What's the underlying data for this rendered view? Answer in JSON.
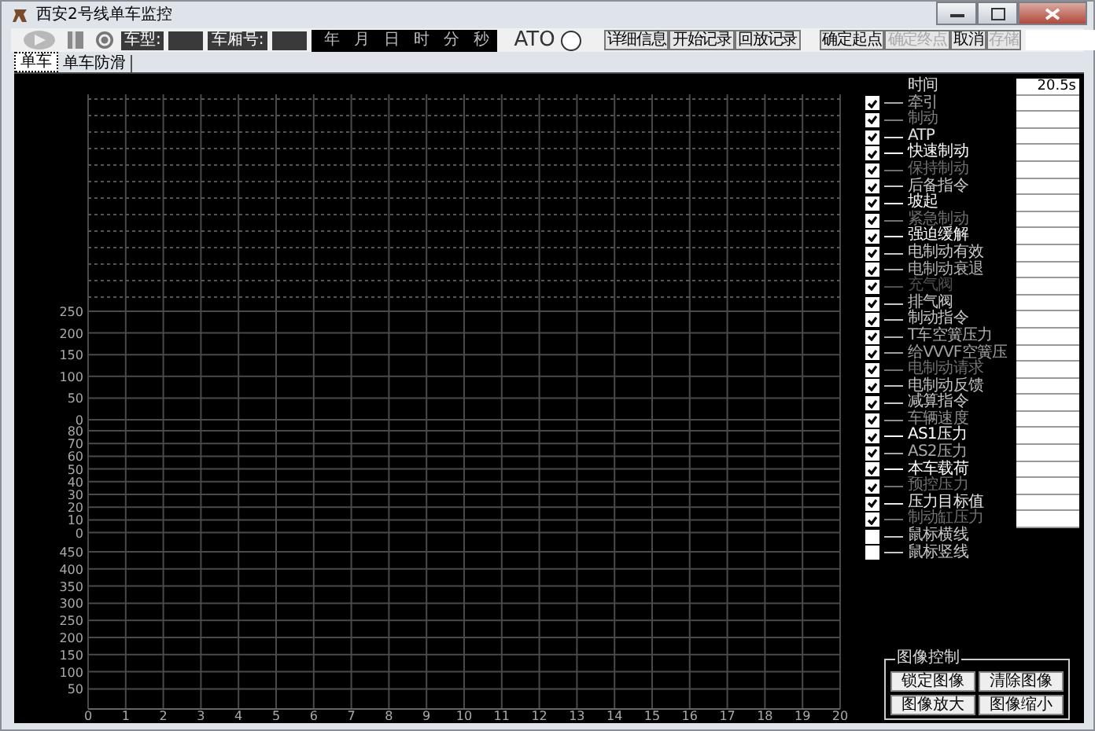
{
  "window": {
    "title": "西安2号线单车监控"
  },
  "toolbar": {
    "vehicle_type_label": "车型:",
    "car_number_label": "车厢号:",
    "datetime_units": [
      "年",
      "月",
      "日",
      "时",
      "分",
      "秒"
    ],
    "ato_label": "ATO",
    "record_buttons": [
      {
        "label": "详细信息",
        "disabled": false
      },
      {
        "label": "开始记录",
        "disabled": false
      },
      {
        "label": "回放记录",
        "disabled": false
      }
    ],
    "range_buttons": [
      {
        "label": "确定起点",
        "disabled": false
      },
      {
        "label": "确定终点",
        "disabled": true
      },
      {
        "label": "取消",
        "disabled": false
      },
      {
        "label": "存储",
        "disabled": true
      }
    ]
  },
  "tabs": [
    {
      "label": "单车",
      "selected": true
    },
    {
      "label": "单车防滑",
      "selected": false
    }
  ],
  "plot": {
    "y_axis_groups": [
      {
        "ticks": [
          "250",
          "200",
          "150",
          "100",
          "50",
          "0"
        ]
      },
      {
        "ticks": [
          "80",
          "70",
          "60",
          "50",
          "40",
          "30",
          "20",
          "10",
          "0"
        ]
      },
      {
        "ticks": [
          "450",
          "400",
          "350",
          "300",
          "250",
          "200",
          "150",
          "100",
          "50"
        ]
      }
    ],
    "x_ticks": [
      "0",
      "1",
      "2",
      "3",
      "4",
      "5",
      "6",
      "7",
      "8",
      "9",
      "10",
      "11",
      "12",
      "13",
      "14",
      "15",
      "16",
      "17",
      "18",
      "19",
      "20"
    ]
  },
  "signals_panel": {
    "time_label": "时间",
    "time_value": "20.5s",
    "signals": [
      {
        "label": "牵引",
        "checked": true,
        "color": "#a8a8a8",
        "kind": "signal"
      },
      {
        "label": "制动",
        "checked": true,
        "color": "#7a7a7a",
        "kind": "signal"
      },
      {
        "label": "ATP",
        "checked": true,
        "color": "#e0e0e0",
        "kind": "signal"
      },
      {
        "label": "快速制动",
        "checked": true,
        "color": "#ffffff",
        "kind": "signal"
      },
      {
        "label": "保持制动",
        "checked": true,
        "color": "#6e6e6e",
        "kind": "signal"
      },
      {
        "label": "后备指令",
        "checked": true,
        "color": "#c8c8c8",
        "kind": "signal"
      },
      {
        "label": "坡起",
        "checked": true,
        "color": "#ffffff",
        "kind": "signal"
      },
      {
        "label": "紧急制动",
        "checked": true,
        "color": "#707070",
        "kind": "signal"
      },
      {
        "label": "强迫缓解",
        "checked": true,
        "color": "#ffffff",
        "kind": "signal"
      },
      {
        "label": "电制动有效",
        "checked": true,
        "color": "#c8c8c8",
        "kind": "signal"
      },
      {
        "label": "电制动衰退",
        "checked": true,
        "color": "#b0b0b0",
        "kind": "signal"
      },
      {
        "label": "充气阀",
        "checked": true,
        "color": "#505050",
        "kind": "signal"
      },
      {
        "label": "排气阀",
        "checked": true,
        "color": "#c8c8c8",
        "kind": "signal"
      },
      {
        "label": "制动指令",
        "checked": true,
        "color": "#c8c8c8",
        "kind": "signal"
      },
      {
        "label": "T车空簧压力",
        "checked": true,
        "color": "#b0b0b0",
        "kind": "signal"
      },
      {
        "label": "给VVVF空簧压",
        "checked": true,
        "color": "#a0a0a0",
        "kind": "signal"
      },
      {
        "label": "电制动请求",
        "checked": true,
        "color": "#707070",
        "kind": "signal"
      },
      {
        "label": "电制动反馈",
        "checked": true,
        "color": "#c0c0c0",
        "kind": "signal"
      },
      {
        "label": "减算指令",
        "checked": true,
        "color": "#c8c8c8",
        "kind": "signal"
      },
      {
        "label": "车辆速度",
        "checked": true,
        "color": "#909090",
        "kind": "signal"
      },
      {
        "label": "AS1压力",
        "checked": true,
        "color": "#ffffff",
        "kind": "signal"
      },
      {
        "label": "AS2压力",
        "checked": true,
        "color": "#a8a8a8",
        "kind": "signal"
      },
      {
        "label": "本车载荷",
        "checked": true,
        "color": "#ffffff",
        "kind": "signal"
      },
      {
        "label": "预控压力",
        "checked": true,
        "color": "#707070",
        "kind": "signal"
      },
      {
        "label": "压力目标值",
        "checked": true,
        "color": "#e8e8e8",
        "kind": "signal"
      },
      {
        "label": "制动缸压力",
        "checked": true,
        "color": "#707070",
        "kind": "signal"
      },
      {
        "label": "鼠标横线",
        "checked": false,
        "color": "#c8c8c8",
        "kind": "cursor"
      },
      {
        "label": "鼠标竖线",
        "checked": false,
        "color": "#c8c8c8",
        "kind": "cursor"
      }
    ]
  },
  "image_control": {
    "title": "图像控制",
    "buttons": [
      "锁定图像",
      "清除图像",
      "图像放大",
      "图像缩小"
    ]
  }
}
